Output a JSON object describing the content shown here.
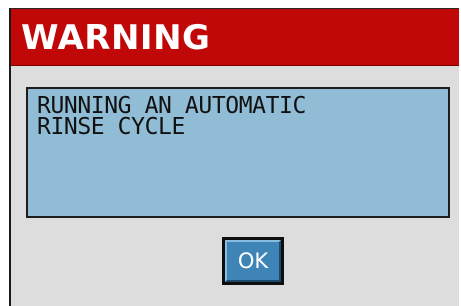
{
  "dialog": {
    "title": "WARNING",
    "message": "RUNNING AN AUTOMATIC\nRINSE CYCLE",
    "ok_label": "OK"
  },
  "colors": {
    "titlebar": "#c00808",
    "dialog_background": "#dddddd",
    "message_background": "#91bcd5",
    "button_face": "#3e84b6"
  }
}
